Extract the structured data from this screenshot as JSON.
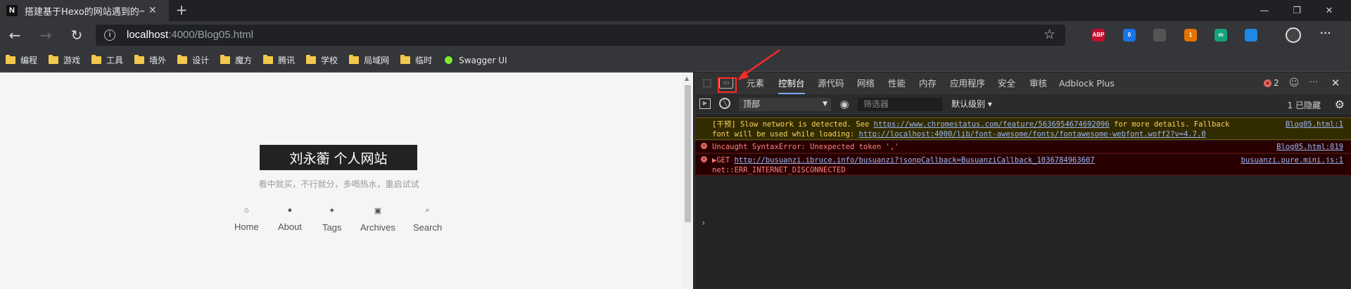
{
  "tab": {
    "favicon": "N",
    "title": "搭建基于Hexo的网站遇到的一些",
    "close": "✕",
    "new_tab": "+"
  },
  "window": {
    "minimize": "—",
    "restore": "❐",
    "close": "✕"
  },
  "nav": {
    "back": "←",
    "forward": "→",
    "reload": "↻"
  },
  "omnibox": {
    "info_icon": "i",
    "host": "localhost",
    "path": ":4000/Blog05.html",
    "star": "☆"
  },
  "extensions": [
    {
      "label": "ABP",
      "color": "#c70d2c"
    },
    {
      "label": "0",
      "color": "#1a73e8"
    },
    {
      "label": "",
      "color": "#555555"
    },
    {
      "label": "1",
      "color": "#e37400"
    },
    {
      "label": "m",
      "color": "#14a37f"
    },
    {
      "label": "",
      "color": "#1e88e5"
    }
  ],
  "toolbar_more": "···",
  "bookmarks": [
    {
      "label": "编程"
    },
    {
      "label": "游戏"
    },
    {
      "label": "工具"
    },
    {
      "label": "墙外"
    },
    {
      "label": "设计"
    },
    {
      "label": "魔方"
    },
    {
      "label": "腾讯"
    },
    {
      "label": "学校"
    },
    {
      "label": "局域网"
    },
    {
      "label": "临时"
    }
  ],
  "swagger": "Swagger UI",
  "page": {
    "site_title": "刘永蘅 个人网站",
    "subtitle": "看中就买，不行就分，多喝热水，重启试试",
    "menu": [
      {
        "icon": "⌂",
        "label": "Home"
      },
      {
        "icon": "●",
        "label": "About"
      },
      {
        "icon": "✦",
        "label": "Tags"
      },
      {
        "icon": "▣",
        "label": "Archives"
      },
      {
        "icon": "⌕",
        "label": "Search"
      }
    ]
  },
  "devtools": {
    "tabs": [
      "元素",
      "控制台",
      "源代码",
      "网络",
      "性能",
      "内存",
      "应用程序",
      "安全",
      "审核",
      "Adblock Plus"
    ],
    "active_tab": "控制台",
    "error_count": "2",
    "more": "···",
    "close": "✕",
    "context": "顶部",
    "filter_placeholder": "筛选器",
    "levels": "默认级别 ▾",
    "hidden": "1 已隐藏",
    "messages": {
      "warn_prefix": "[干预] Slow network is detected. See ",
      "warn_link": "https://www.chromestatus.com/feature/5636954674692096",
      "warn_mid": " for more details. Fallback",
      "warn_line2": "font will be used while loading: ",
      "warn_link2": "http://localhost:4000/lib/font-awesome/fonts/fontawesome-webfont.woff2?v=4.7.0",
      "warn_loc": "Blog05.html:1",
      "err1_text": "Uncaught SyntaxError: Unexpected token ','",
      "err1_loc": "Blog05.html:819",
      "err2_prefix": "▶GET ",
      "err2_link": "http://busuanzi.ibruce.info/busuanzi?jsonpCallback=BusuanziCallback_1036784963607",
      "err2_loc": "busuanzi.pure.mini.js:1",
      "err2_line2": "net::ERR_INTERNET_DISCONNECTED",
      "prompt": "›"
    }
  },
  "colors": {
    "annotation": "#ff2a2a",
    "active_tab_underline": "#7cacf8"
  }
}
